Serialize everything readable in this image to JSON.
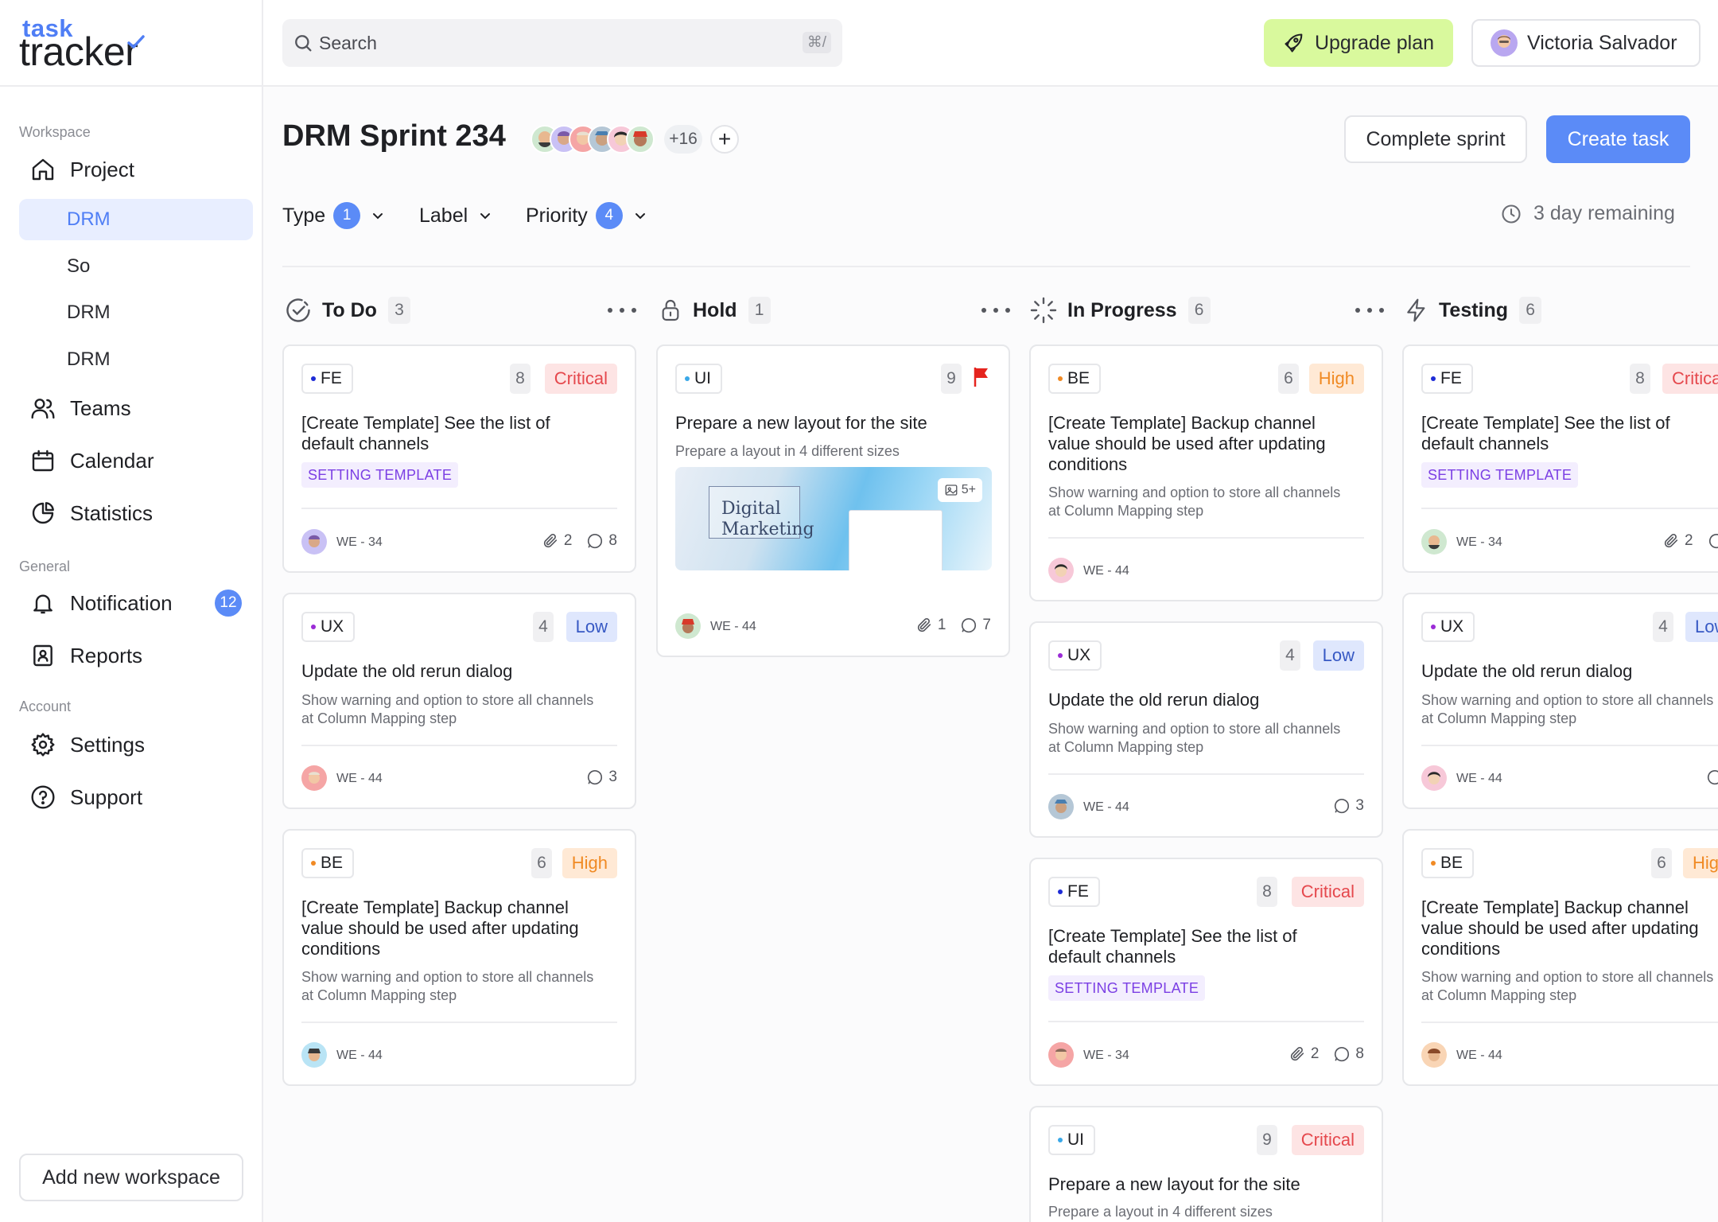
{
  "app": {
    "logo_top": "task",
    "logo_bottom": "tracker"
  },
  "sidebar": {
    "workspace_label": "Workspace",
    "general_label": "General",
    "account_label": "Account",
    "project": "Project",
    "sub_items": [
      "DRM",
      "So",
      "DRM",
      "DRM"
    ],
    "teams": "Teams",
    "calendar": "Calendar",
    "statistics": "Statistics",
    "notification": "Notification",
    "notification_count": "12",
    "reports": "Reports",
    "settings": "Settings",
    "support": "Support",
    "add_workspace": "Add new workspace"
  },
  "topbar": {
    "search_placeholder": "Search",
    "search_shortcut": "⌘/",
    "upgrade": "Upgrade plan",
    "user_name": "Victoria Salvador"
  },
  "header": {
    "sprint_title": "DRM Sprint 234",
    "more_members": "+16",
    "add_member": "+",
    "complete_sprint": "Complete sprint",
    "create_task": "Create task",
    "remaining": "3 day remaining"
  },
  "filters": {
    "type": "Type",
    "type_count": "1",
    "label": "Label",
    "priority": "Priority",
    "priority_count": "4"
  },
  "columns": [
    {
      "title": "To Do",
      "count": "3",
      "cards": [
        {
          "tag": "FE",
          "points": "8",
          "priority": "Critical",
          "title_lines": [
            "[Create Template] See the list of",
            "default channels"
          ],
          "label": "SETTING TEMPLATE",
          "id": "WE - 34",
          "attachments": "2",
          "comments": "8"
        },
        {
          "tag": "UX",
          "points": "4",
          "priority": "Low",
          "title_lines": [
            "Update the old rerun dialog"
          ],
          "desc_lines": [
            "Show warning and option to store all channels",
            "at Column Mapping step"
          ],
          "id": "WE - 44",
          "comments": "3"
        },
        {
          "tag": "BE",
          "points": "6",
          "priority": "High",
          "title_lines": [
            "[Create Template] Backup channel",
            "value should be used after updating",
            "conditions"
          ],
          "desc_lines": [
            "Show warning and option to store all channels",
            "at Column Mapping step"
          ],
          "id": "WE - 44"
        }
      ]
    },
    {
      "title": "Hold",
      "count": "1",
      "cards": [
        {
          "tag": "UI",
          "points": "9",
          "flag": "red-flag-icon",
          "title_lines": [
            "Prepare a new layout for the site"
          ],
          "desc_lines": [
            "Prepare a layout in 4 different sizes"
          ],
          "image_text": [
            "Digital",
            "Marketing"
          ],
          "image_count": "5+",
          "id": "WE - 44",
          "attachments": "1",
          "comments": "7"
        }
      ]
    },
    {
      "title": "In Progress",
      "count": "6",
      "cards": [
        {
          "tag": "BE",
          "points": "6",
          "priority": "High",
          "title_lines": [
            "[Create Template] Backup channel",
            "value should be used after updating",
            "conditions"
          ],
          "desc_lines": [
            "Show warning and option to store all channels",
            "at Column Mapping step"
          ],
          "id": "WE - 44"
        },
        {
          "tag": "UX",
          "points": "4",
          "priority": "Low",
          "title_lines": [
            "Update the old rerun dialog"
          ],
          "desc_lines": [
            "Show warning and option to store all channels",
            "at Column Mapping step"
          ],
          "id": "WE - 44",
          "comments": "3"
        },
        {
          "tag": "FE",
          "points": "8",
          "priority": "Critical",
          "title_lines": [
            "[Create Template] See the list of",
            "default channels"
          ],
          "label": "SETTING TEMPLATE",
          "id": "WE - 34",
          "attachments": "2",
          "comments": "8"
        },
        {
          "tag": "UI",
          "points": "9",
          "priority": "Critical",
          "title_lines": [
            "Prepare a new layout for the site"
          ],
          "desc_lines": [
            "Prepare a layout in 4 different sizes"
          ]
        }
      ]
    },
    {
      "title": "Testing",
      "count": "6",
      "cards": [
        {
          "tag": "FE",
          "points": "8",
          "priority": "Critical",
          "title_lines": [
            "[Create Template] See the list of",
            "default channels"
          ],
          "label": "SETTING TEMPLATE",
          "id": "WE - 34",
          "attachments": "2"
        },
        {
          "tag": "UX",
          "points": "4",
          "priority": "Low",
          "title_lines": [
            "Update the old rerun dialog"
          ],
          "desc_lines": [
            "Show warning and option to store all channels",
            "at Column Mapping step"
          ],
          "id": "WE - 44"
        },
        {
          "tag": "BE",
          "points": "6",
          "priority": "High",
          "title_lines": [
            "[Create Template] Backup channel",
            "value should be used after updating",
            "conditions"
          ],
          "desc_lines": [
            "Show warning and option to store all channels",
            "at Column Mapping step"
          ],
          "id": "WE - 44"
        }
      ]
    }
  ],
  "colors": {
    "accent": "#5b8bf7",
    "upgrade_bg": "#d9f99d",
    "critical": "#e5484d",
    "high": "#f08a24",
    "low": "#3759c4",
    "label_purple": "#7b3fe4",
    "tag_FE": "#1d2bd6",
    "tag_UX": "#9b2bd6",
    "tag_BE": "#f08a24",
    "tag_UI": "#3aa8e8"
  }
}
